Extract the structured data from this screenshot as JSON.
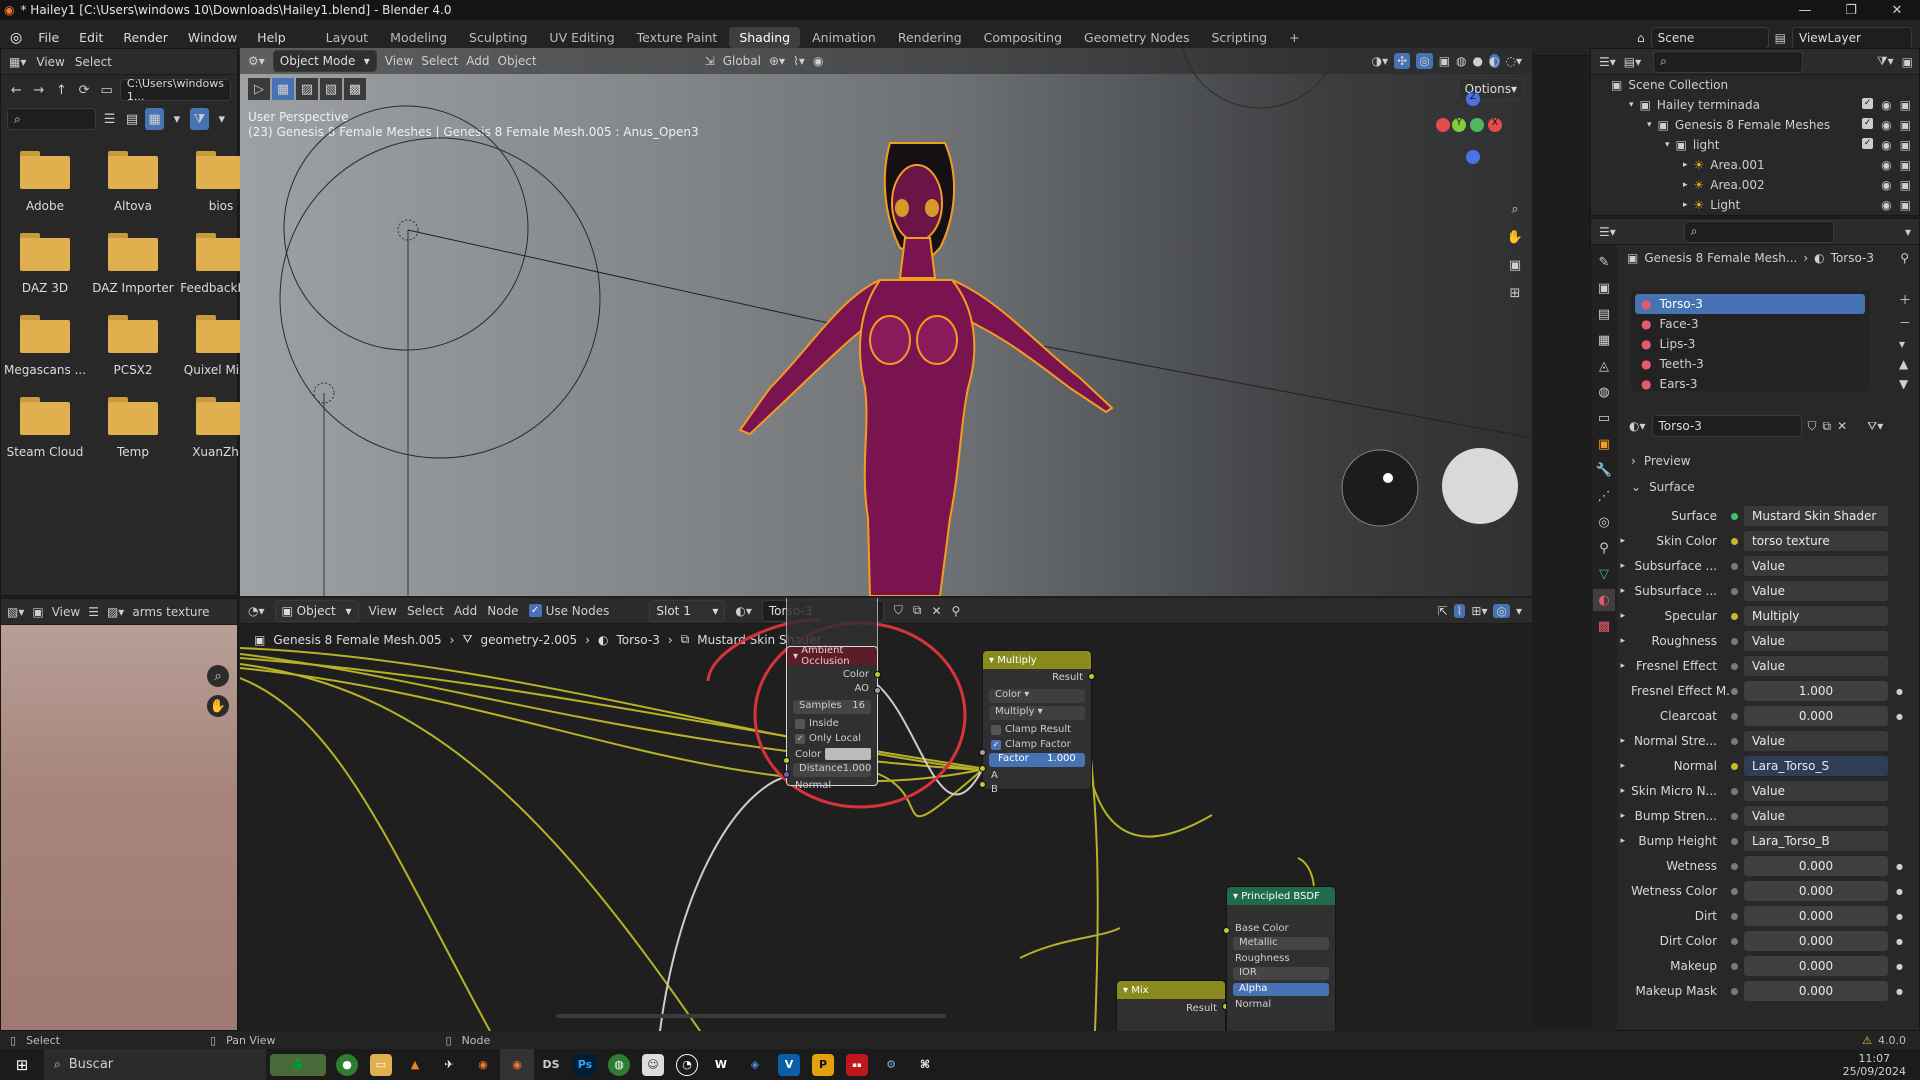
{
  "window": {
    "title": "* Hailey1 [C:\\Users\\windows 10\\Downloads\\Hailey1.blend] - Blender 4.0"
  },
  "menu": [
    "File",
    "Edit",
    "Render",
    "Window",
    "Help"
  ],
  "workspaces": [
    "Layout",
    "Modeling",
    "Sculpting",
    "UV Editing",
    "Texture Paint",
    "Shading",
    "Animation",
    "Rendering",
    "Compositing",
    "Geometry Nodes",
    "Scripting"
  ],
  "active_workspace": "Shading",
  "scene": {
    "name": "Scene",
    "view_layer": "ViewLayer"
  },
  "file_browser": {
    "menu": [
      "View",
      "Select"
    ],
    "path": "C:\\Users\\windows 1...",
    "folders": [
      "Adobe",
      "Altova",
      "bios",
      "DAZ 3D",
      "DAZ Importer",
      "FeedbackHub",
      "Megascans ...",
      "PCSX2",
      "Quixel Mixer",
      "Steam Cloud",
      "Temp",
      "XuanZhi9"
    ]
  },
  "viewport": {
    "mode": "Object Mode",
    "menu": [
      "View",
      "Select",
      "Add",
      "Object"
    ],
    "transform": "Global",
    "options_label": "Options",
    "perspective": "User Perspective",
    "info": "(23) Genesis 8 Female Meshes | Genesis 8 Female Mesh.005 : Anus_Open3",
    "gizmo": {
      "z": "Z",
      "y": "Y",
      "x": "X"
    }
  },
  "image_editor": {
    "view": "View",
    "image": "arms texture"
  },
  "node_editor": {
    "object": "Object",
    "menu": [
      "View",
      "Select",
      "Add",
      "Node"
    ],
    "use_nodes": "Use Nodes",
    "slot": "Slot 1",
    "material": "Torso-3",
    "breadcrumb": [
      "Genesis 8 Female Mesh.005",
      "geometry-2.005",
      "Torso-3",
      "Mustard Skin Shader"
    ],
    "ao_node": {
      "title": "Ambient Occlusion",
      "out_color": "Color",
      "out_ao": "AO",
      "samples_label": "Samples",
      "samples_value": "16",
      "inside": "Inside",
      "only_local": "Only Local",
      "color": "Color",
      "distance_label": "Distance",
      "distance_value": "1.000",
      "normal": "Normal"
    },
    "multiply_node": {
      "title": "Multiply",
      "result": "Result",
      "type": "Color",
      "blend": "Multiply",
      "clamp_result": "Clamp Result",
      "clamp_factor": "Clamp Factor",
      "factor_label": "Factor",
      "factor_value": "1.000",
      "a": "A",
      "b": "B"
    },
    "mix_node": {
      "title": "Mix",
      "result": "Result"
    },
    "bsdf_node": {
      "title": "Principled BSDF",
      "inputs": [
        "Base Color",
        "Metallic",
        "Roughness",
        "IOR",
        "Alpha",
        "Normal"
      ]
    }
  },
  "outliner": {
    "root": "Scene Collection",
    "items": [
      {
        "label": "Hailey terminada",
        "indent": 1
      },
      {
        "label": "Genesis 8 Female Meshes",
        "indent": 2
      },
      {
        "label": "light",
        "indent": 3
      },
      {
        "label": "Area.001",
        "indent": 4
      },
      {
        "label": "Area.002",
        "indent": 4
      },
      {
        "label": "Light",
        "indent": 4
      }
    ]
  },
  "properties": {
    "breadcrumb": [
      "Genesis 8 Female Mesh...",
      "Torso-3"
    ],
    "slots": [
      "Torso-3",
      "Face-3",
      "Lips-3",
      "Teeth-3",
      "Ears-3"
    ],
    "active_slot": "Torso-3",
    "material": "Torso-3",
    "preview_label": "Preview",
    "surface_label": "Surface",
    "rows": [
      {
        "label": "Surface",
        "value": "Mustard Skin Shader",
        "dot": "g",
        "expand": false
      },
      {
        "label": "Skin Color",
        "value": "torso texture",
        "dot": "y",
        "expand": true
      },
      {
        "label": "Subsurface ...",
        "value": "Value",
        "dot": "n",
        "expand": true
      },
      {
        "label": "Subsurface ...",
        "value": "Value",
        "dot": "n",
        "expand": true
      },
      {
        "label": "Specular",
        "value": "Multiply",
        "dot": "y",
        "expand": true
      },
      {
        "label": "Roughness",
        "value": "Value",
        "dot": "n",
        "expand": true
      },
      {
        "label": "Fresnel Effect",
        "value": "Value",
        "dot": "n",
        "expand": true
      },
      {
        "label": "Fresnel Effect M...",
        "value": "1.000",
        "dot": "n",
        "expand": false
      },
      {
        "label": "Clearcoat",
        "value": "0.000",
        "dot": "n",
        "expand": false
      },
      {
        "label": "Normal Stre...",
        "value": "Value",
        "dot": "n",
        "expand": true
      },
      {
        "label": "Normal",
        "value": "Lara_Torso_S",
        "dot": "y",
        "expand": true
      },
      {
        "label": "Skin Micro N...",
        "value": "Value",
        "dot": "n",
        "expand": true
      },
      {
        "label": "Bump Stren...",
        "value": "Value",
        "dot": "n",
        "expand": true
      },
      {
        "label": "Bump Height",
        "value": "Lara_Torso_B",
        "dot": "n",
        "expand": true
      },
      {
        "label": "Wetness",
        "value": "0.000",
        "dot": "n",
        "expand": false
      },
      {
        "label": "Wetness Color",
        "value": "0.000",
        "dot": "n",
        "expand": false
      },
      {
        "label": "Dirt",
        "value": "0.000",
        "dot": "n",
        "expand": false
      },
      {
        "label": "Dirt Color",
        "value": "0.000",
        "dot": "n",
        "expand": false
      },
      {
        "label": "Makeup",
        "value": "0.000",
        "dot": "n",
        "expand": false
      },
      {
        "label": "Makeup Mask",
        "value": "0.000",
        "dot": "n",
        "expand": false
      }
    ]
  },
  "statusbar": {
    "select": "Select",
    "pan": "Pan View",
    "node": "Node",
    "version": "4.0.0"
  },
  "taskbar": {
    "search": "Buscar",
    "time": "11:07",
    "date": "25/09/2024"
  },
  "colors": {
    "accent": "#4772b3",
    "selection_outline": "#f59c1f",
    "annotation": "#d8323f",
    "socket_yellow": "#c7c729"
  }
}
